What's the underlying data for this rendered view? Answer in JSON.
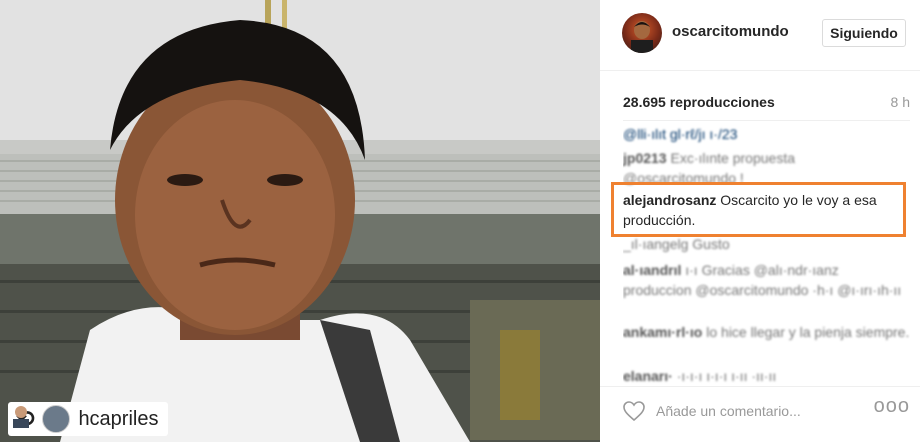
{
  "post": {
    "username": "oscarcitomundo",
    "follow_label": "Siguiendo",
    "views": "28.695 reproducciones",
    "time": "8 h"
  },
  "repost": {
    "icon": "repost-icon",
    "username": "hcapriles"
  },
  "comments": [
    {
      "user": "",
      "text": "@lli·ılıt gl·rℓ/jı ı·/23",
      "blurred": true
    },
    {
      "user": "jp0213",
      "text": "Exc·ılınte propuesta @oscarcitomundo !",
      "blurred": true
    },
    {
      "user": "alejandrosanz",
      "text": "Oscarcito yo le voy a esa producción.",
      "blurred": false
    },
    {
      "user": "",
      "text": "_ıl·ıangelg Gusto",
      "blurred": true
    },
    {
      "user": "al·ıandrıl",
      "text": "ı·ı Gracias @alı·ndr·ıanz produccion @oscarcitomundo ·h·ı @ı·ırı·ıh·ıı",
      "blurred": true
    },
    {
      "user": "ankamı·rl·ıo",
      "text": "lo hice llegar y la pienja siempre.",
      "blurred": true
    },
    {
      "user": "elanarı·",
      "text": "·ı·ı·ı ı·ı·ı ı·ıı ·ıı·ıı",
      "blurred": true
    }
  ],
  "footer": {
    "comment_placeholder": "Añade un comentario...",
    "more_label": "ooo",
    "like_icon": "heart-icon"
  },
  "colors": {
    "highlight": "#ef8130",
    "text": "#262626",
    "muted": "#999999"
  }
}
